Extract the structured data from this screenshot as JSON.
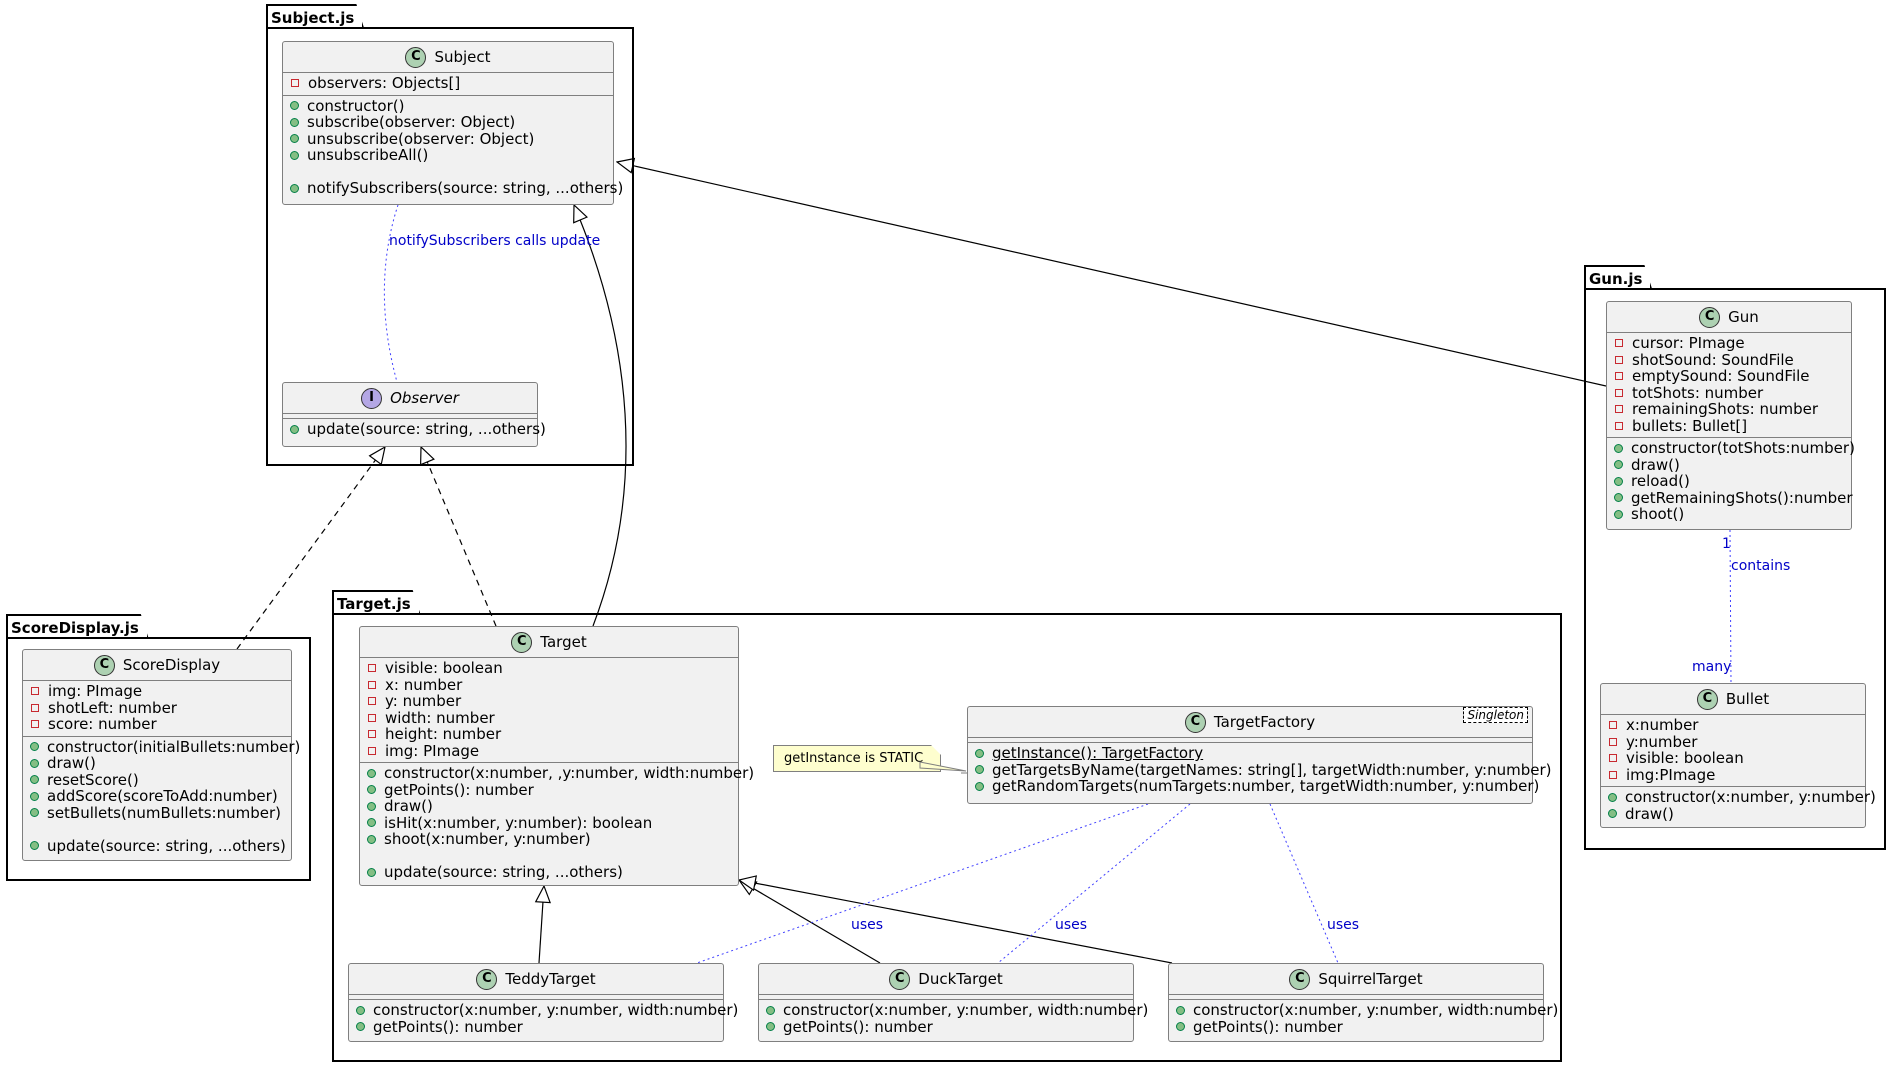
{
  "packages": {
    "subject": "Subject.js",
    "gun": "Gun.js",
    "target": "Target.js",
    "score": "ScoreDisplay.js"
  },
  "classes": {
    "subject": {
      "name": "Subject",
      "fields": [
        "observers: Objects[]"
      ],
      "methods": [
        "constructor()",
        "subscribe(observer: Object)",
        "unsubscribe(observer: Object)",
        "unsubscribeAll()",
        "",
        "notifySubscribers(source: string, ...others)"
      ]
    },
    "observer": {
      "name": "Observer",
      "methods": [
        "update(source: string, ...others)"
      ]
    },
    "gun": {
      "name": "Gun",
      "fields": [
        "cursor: PImage",
        "shotSound: SoundFile",
        "emptySound: SoundFile",
        "totShots: number",
        "remainingShots: number",
        "bullets: Bullet[]"
      ],
      "methods": [
        "constructor(totShots:number)",
        "draw()",
        "reload()",
        "getRemainingShots():number",
        "shoot()"
      ]
    },
    "bullet": {
      "name": "Bullet",
      "fields": [
        "x:number",
        "y:number",
        "visible: boolean",
        "img:PImage"
      ],
      "methods": [
        "constructor(x:number, y:number)",
        "draw()"
      ]
    },
    "scoreDisplay": {
      "name": "ScoreDisplay",
      "fields": [
        "img: PImage",
        "shotLeft: number",
        "score: number"
      ],
      "methods": [
        "constructor(initialBullets:number)",
        "draw()",
        "resetScore()",
        "addScore(scoreToAdd:number)",
        "setBullets(numBullets:number)",
        "",
        "update(source: string, ...others)"
      ]
    },
    "target": {
      "name": "Target",
      "fields": [
        "visible: boolean",
        "x: number",
        "y: number",
        "width: number",
        "height: number",
        "img: PImage"
      ],
      "methods": [
        "constructor(x:number, ,y:number, width:number)",
        "getPoints(): number",
        "draw()",
        "isHit(x:number, y:number): boolean",
        "shoot(x:number, y:number)",
        "",
        "update(source: string, ...others)"
      ]
    },
    "targetFactory": {
      "name": "TargetFactory",
      "stereotype": "Singleton",
      "methods": [
        "getInstance(): TargetFactory",
        "getTargetsByName(targetNames: string[], targetWidth:number, y:number)",
        "getRandomTargets(numTargets:number, targetWidth:number, y:number)"
      ]
    },
    "teddy": {
      "name": "TeddyTarget",
      "methods": [
        "constructor(x:number, y:number, width:number)",
        "getPoints(): number"
      ]
    },
    "duck": {
      "name": "DuckTarget",
      "methods": [
        "constructor(x:number, y:number, width:number)",
        "getPoints(): number"
      ]
    },
    "squirrel": {
      "name": "SquirrelTarget",
      "methods": [
        "constructor(x:number, y:number, width:number)",
        "getPoints(): number"
      ]
    }
  },
  "labels": {
    "notify": "notifySubscribers calls update",
    "contains": "contains",
    "one": "1",
    "many": "many",
    "uses1": "uses",
    "uses2": "uses",
    "uses3": "uses"
  },
  "note": "getInstance is STATIC",
  "badges": {
    "class": "C",
    "interface": "I"
  },
  "colors": {
    "link": "#0000c8",
    "classBg": "#f1f1f1",
    "classBadge": "#add1b2",
    "interfaceBadge": "#b4a7e5"
  }
}
